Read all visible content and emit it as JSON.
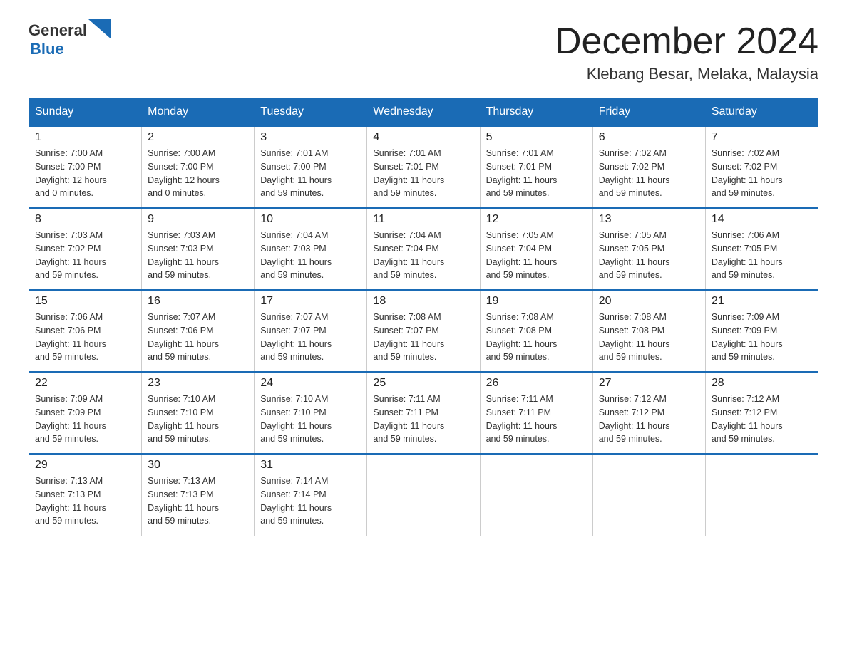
{
  "header": {
    "logo_general": "General",
    "logo_blue": "Blue",
    "month_title": "December 2024",
    "location": "Klebang Besar, Melaka, Malaysia"
  },
  "weekdays": [
    "Sunday",
    "Monday",
    "Tuesday",
    "Wednesday",
    "Thursday",
    "Friday",
    "Saturday"
  ],
  "weeks": [
    [
      {
        "day": "1",
        "sunrise": "7:00 AM",
        "sunset": "7:00 PM",
        "daylight": "12 hours and 0 minutes."
      },
      {
        "day": "2",
        "sunrise": "7:00 AM",
        "sunset": "7:00 PM",
        "daylight": "12 hours and 0 minutes."
      },
      {
        "day": "3",
        "sunrise": "7:01 AM",
        "sunset": "7:00 PM",
        "daylight": "11 hours and 59 minutes."
      },
      {
        "day": "4",
        "sunrise": "7:01 AM",
        "sunset": "7:01 PM",
        "daylight": "11 hours and 59 minutes."
      },
      {
        "day": "5",
        "sunrise": "7:01 AM",
        "sunset": "7:01 PM",
        "daylight": "11 hours and 59 minutes."
      },
      {
        "day": "6",
        "sunrise": "7:02 AM",
        "sunset": "7:02 PM",
        "daylight": "11 hours and 59 minutes."
      },
      {
        "day": "7",
        "sunrise": "7:02 AM",
        "sunset": "7:02 PM",
        "daylight": "11 hours and 59 minutes."
      }
    ],
    [
      {
        "day": "8",
        "sunrise": "7:03 AM",
        "sunset": "7:02 PM",
        "daylight": "11 hours and 59 minutes."
      },
      {
        "day": "9",
        "sunrise": "7:03 AM",
        "sunset": "7:03 PM",
        "daylight": "11 hours and 59 minutes."
      },
      {
        "day": "10",
        "sunrise": "7:04 AM",
        "sunset": "7:03 PM",
        "daylight": "11 hours and 59 minutes."
      },
      {
        "day": "11",
        "sunrise": "7:04 AM",
        "sunset": "7:04 PM",
        "daylight": "11 hours and 59 minutes."
      },
      {
        "day": "12",
        "sunrise": "7:05 AM",
        "sunset": "7:04 PM",
        "daylight": "11 hours and 59 minutes."
      },
      {
        "day": "13",
        "sunrise": "7:05 AM",
        "sunset": "7:05 PM",
        "daylight": "11 hours and 59 minutes."
      },
      {
        "day": "14",
        "sunrise": "7:06 AM",
        "sunset": "7:05 PM",
        "daylight": "11 hours and 59 minutes."
      }
    ],
    [
      {
        "day": "15",
        "sunrise": "7:06 AM",
        "sunset": "7:06 PM",
        "daylight": "11 hours and 59 minutes."
      },
      {
        "day": "16",
        "sunrise": "7:07 AM",
        "sunset": "7:06 PM",
        "daylight": "11 hours and 59 minutes."
      },
      {
        "day": "17",
        "sunrise": "7:07 AM",
        "sunset": "7:07 PM",
        "daylight": "11 hours and 59 minutes."
      },
      {
        "day": "18",
        "sunrise": "7:08 AM",
        "sunset": "7:07 PM",
        "daylight": "11 hours and 59 minutes."
      },
      {
        "day": "19",
        "sunrise": "7:08 AM",
        "sunset": "7:08 PM",
        "daylight": "11 hours and 59 minutes."
      },
      {
        "day": "20",
        "sunrise": "7:08 AM",
        "sunset": "7:08 PM",
        "daylight": "11 hours and 59 minutes."
      },
      {
        "day": "21",
        "sunrise": "7:09 AM",
        "sunset": "7:09 PM",
        "daylight": "11 hours and 59 minutes."
      }
    ],
    [
      {
        "day": "22",
        "sunrise": "7:09 AM",
        "sunset": "7:09 PM",
        "daylight": "11 hours and 59 minutes."
      },
      {
        "day": "23",
        "sunrise": "7:10 AM",
        "sunset": "7:10 PM",
        "daylight": "11 hours and 59 minutes."
      },
      {
        "day": "24",
        "sunrise": "7:10 AM",
        "sunset": "7:10 PM",
        "daylight": "11 hours and 59 minutes."
      },
      {
        "day": "25",
        "sunrise": "7:11 AM",
        "sunset": "7:11 PM",
        "daylight": "11 hours and 59 minutes."
      },
      {
        "day": "26",
        "sunrise": "7:11 AM",
        "sunset": "7:11 PM",
        "daylight": "11 hours and 59 minutes."
      },
      {
        "day": "27",
        "sunrise": "7:12 AM",
        "sunset": "7:12 PM",
        "daylight": "11 hours and 59 minutes."
      },
      {
        "day": "28",
        "sunrise": "7:12 AM",
        "sunset": "7:12 PM",
        "daylight": "11 hours and 59 minutes."
      }
    ],
    [
      {
        "day": "29",
        "sunrise": "7:13 AM",
        "sunset": "7:13 PM",
        "daylight": "11 hours and 59 minutes."
      },
      {
        "day": "30",
        "sunrise": "7:13 AM",
        "sunset": "7:13 PM",
        "daylight": "11 hours and 59 minutes."
      },
      {
        "day": "31",
        "sunrise": "7:14 AM",
        "sunset": "7:14 PM",
        "daylight": "11 hours and 59 minutes."
      },
      null,
      null,
      null,
      null
    ]
  ],
  "labels": {
    "sunrise": "Sunrise:",
    "sunset": "Sunset:",
    "daylight": "Daylight:"
  }
}
